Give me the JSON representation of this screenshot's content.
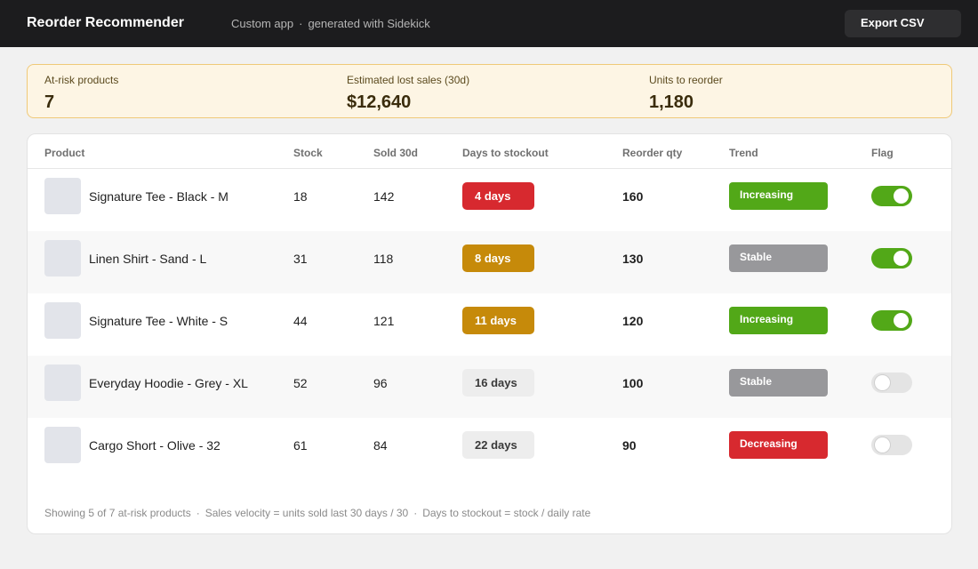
{
  "header": {
    "title": "Reorder Recommender",
    "subtitle_app": "Custom app",
    "subtitle_sep": "·",
    "subtitle_gen": "generated with Sidekick",
    "export_label": "Export CSV"
  },
  "summary": {
    "at_risk_label": "At-risk products",
    "at_risk_value": "7",
    "lost_sales_label": "Estimated lost sales (30d)",
    "lost_sales_value": "$12,640",
    "units_label": "Units to reorder",
    "units_value": "1,180"
  },
  "table": {
    "columns": [
      "Product",
      "Stock",
      "Sold 30d",
      "Days to stockout",
      "Reorder qty",
      "Trend",
      "Flag"
    ],
    "rows": [
      {
        "product": "Signature Tee - Black - M",
        "stock": "18",
        "sold": "142",
        "days": "4 days",
        "days_color": "#d7292f",
        "days_text_color": "#ffffff",
        "reorder": "160",
        "trend": "Increasing",
        "trend_color": "#52a818",
        "flag_on": true
      },
      {
        "product": "Linen Shirt - Sand - L",
        "stock": "31",
        "sold": "118",
        "days": "8 days",
        "days_color": "#c68a0a",
        "days_text_color": "#ffffff",
        "reorder": "130",
        "trend": "Stable",
        "trend_color": "#98989b",
        "flag_on": true
      },
      {
        "product": "Signature Tee - White - S",
        "stock": "44",
        "sold": "121",
        "days": "11 days",
        "days_color": "#c68a0a",
        "days_text_color": "#ffffff",
        "reorder": "120",
        "trend": "Increasing",
        "trend_color": "#52a818",
        "flag_on": true
      },
      {
        "product": "Everyday Hoodie - Grey - XL",
        "stock": "52",
        "sold": "96",
        "days": "16 days",
        "days_color": "#ededed",
        "days_text_color": "#3a3a3a",
        "reorder": "100",
        "trend": "Stable",
        "trend_color": "#98989b",
        "flag_on": false
      },
      {
        "product": "Cargo Short - Olive - 32",
        "stock": "61",
        "sold": "84",
        "days": "22 days",
        "days_color": "#ededed",
        "days_text_color": "#3a3a3a",
        "reorder": "90",
        "trend": "Decreasing",
        "trend_color": "#d7292f",
        "flag_on": false
      }
    ]
  },
  "footer": {
    "showing": "Showing 5 of 7 at-risk products",
    "sep": "·",
    "velocity": "Sales velocity = units sold last 30 days / 30",
    "stockout": "Days to stockout = stock / daily rate"
  },
  "colors": {
    "toggle_on": "#52a818",
    "toggle_off": "#e4e4e4"
  }
}
